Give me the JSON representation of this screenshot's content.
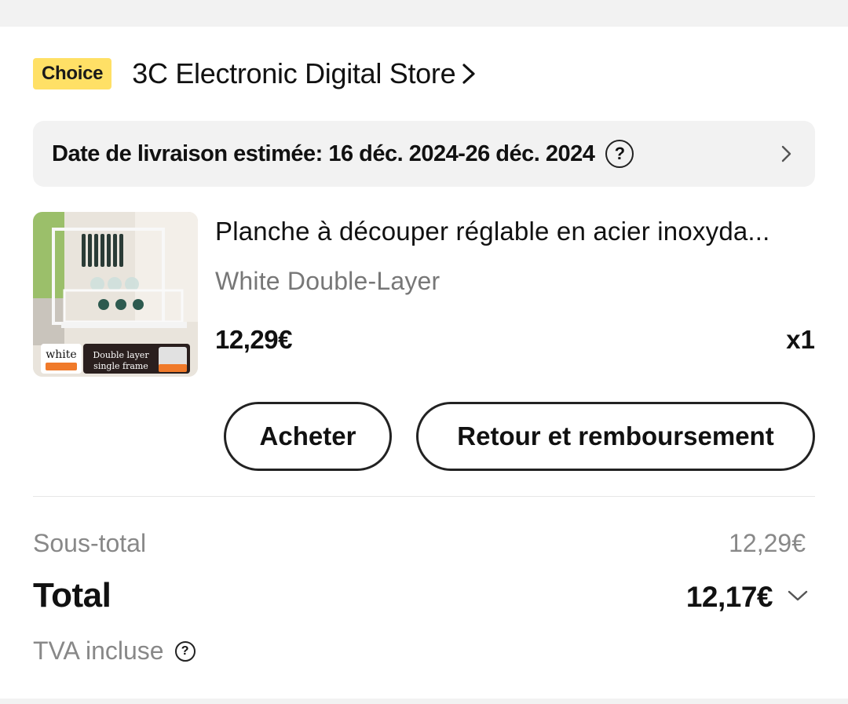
{
  "store": {
    "badge": "Choice",
    "name": "3C Electronic Digital Store",
    "badge_color": "#ffe066"
  },
  "delivery": {
    "text": "Date de livraison estimée: 16 déc. 2024-26 déc. 2024",
    "help_icon": "question-circle-icon",
    "chevron_icon": "chevron-right-icon"
  },
  "product": {
    "title": "Planche à découper réglable en acier inoxyda...",
    "variant": "White Double-Layer",
    "price": "12,29€",
    "quantity": "x1",
    "image": {
      "label_color": "white",
      "label_text": "Double layer single frame"
    }
  },
  "actions": {
    "buy": "Acheter",
    "return": "Retour et remboursement"
  },
  "summary": {
    "subtotal_label": "Sous-total",
    "subtotal_value": "12,29€",
    "total_label": "Total",
    "total_value": "12,17€",
    "tax_label": "TVA incluse"
  }
}
